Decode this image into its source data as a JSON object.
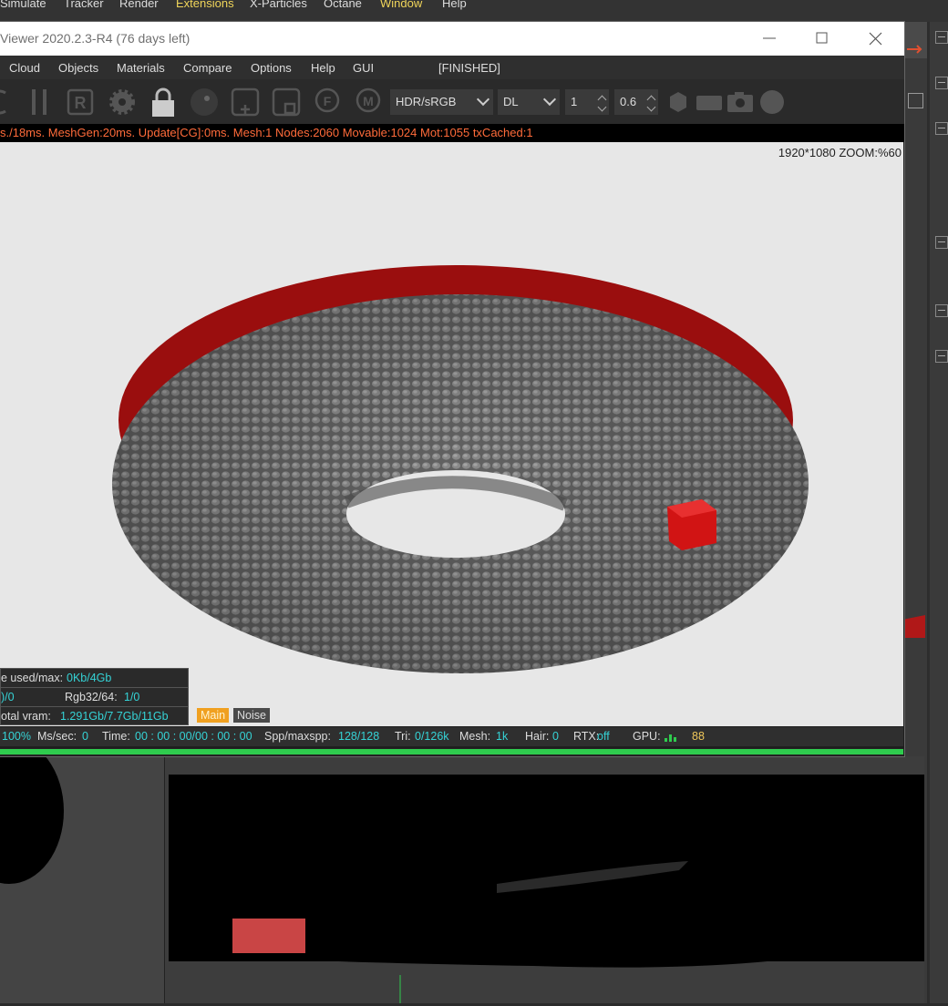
{
  "c4d_menu": [
    {
      "label": "Simulate",
      "highlight": false
    },
    {
      "label": "Tracker",
      "highlight": false
    },
    {
      "label": "Render",
      "highlight": false
    },
    {
      "label": "Extensions",
      "highlight": true
    },
    {
      "label": "X-Particles",
      "highlight": false
    },
    {
      "label": "Octane",
      "highlight": false
    },
    {
      "label": "Window",
      "highlight": true
    },
    {
      "label": "Help",
      "highlight": false
    }
  ],
  "window": {
    "title": "Viewer 2020.2.3-R4 (76 days left)"
  },
  "menu": {
    "items": [
      "Cloud",
      "Objects",
      "Materials",
      "Compare",
      "Options",
      "Help",
      "GUI"
    ],
    "status": "[FINISHED]"
  },
  "toolbar": {
    "icons": [
      "refresh-icon",
      "pause-icon",
      "r-button-icon",
      "settings-icon",
      "lock-icon",
      "sphere-icon",
      "add-region-icon",
      "region-icon",
      "focus-pin-icon",
      "material-pin-icon"
    ],
    "tonemap": "HDR/sRGB",
    "kernel": "DL",
    "value1": "1",
    "value2": "0.6",
    "right_icons": [
      "hexagon-icon",
      "film-icon",
      "camera-icon",
      "ball-icon"
    ]
  },
  "status_line": "s./18ms. MeshGen:20ms. Update[CG]:0ms. Mesh:1 Nodes:2060 Movable:1024 Mot:1055 txCached:1",
  "render": {
    "resolution_zoom": "1920*1080 ZOOM:%60"
  },
  "info": {
    "used_label": "e used/max:",
    "used_value": "0Kb/4Gb",
    "row2_left": ")/0",
    "rgb_label": "Rgb32/64:",
    "rgb_value": "1/0",
    "vram_label": "otal vram:",
    "vram_value": "1.291Gb/7.7Gb/11Gb",
    "tag_main": "Main",
    "tag_noise": "Noise"
  },
  "bottom_stats": {
    "percent": "100%",
    "ms_label": "Ms/sec:",
    "ms_value": "0",
    "time_label": "Time:",
    "time_value": "00 : 00 : 00/00 : 00 : 00",
    "spp_label": "Spp/maxspp:",
    "spp_value": "128/128",
    "tri_label": "Tri:",
    "tri_value": "0/126k",
    "mesh_label": "Mesh:",
    "mesh_value": "1k",
    "hair_label": "Hair:",
    "hair_value": "0",
    "rtx_label": "RTX:",
    "rtx_value": "off",
    "gpu_label": "GPU:",
    "gpu_value": "88"
  },
  "progress": {
    "fraction": 1.0
  },
  "colors": {
    "accent_yellow": "#f0c75a",
    "cyan": "#35d3d6",
    "orange": "#ff6b3a",
    "green": "#2fcc4e",
    "tag_main": "#f0a020"
  }
}
